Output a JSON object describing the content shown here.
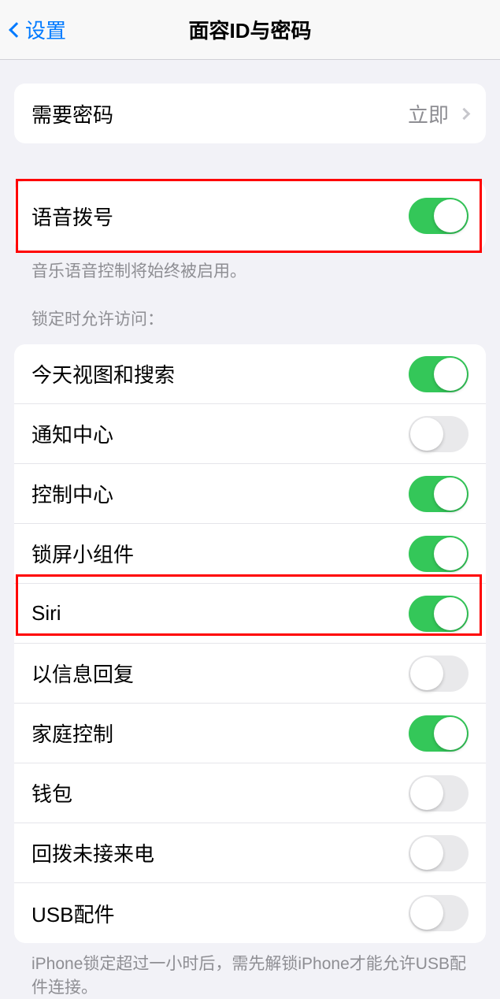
{
  "nav": {
    "back_label": "设置",
    "title": "面容ID与密码"
  },
  "require_passcode": {
    "label": "需要密码",
    "value": "立即"
  },
  "voice_dial": {
    "label": "语音拨号",
    "on": true,
    "footer": "音乐语音控制将始终被启用。"
  },
  "lock_access": {
    "header": "锁定时允许访问：",
    "items": [
      {
        "label": "今天视图和搜索",
        "on": true
      },
      {
        "label": "通知中心",
        "on": false
      },
      {
        "label": "控制中心",
        "on": true
      },
      {
        "label": "锁屏小组件",
        "on": true
      },
      {
        "label": "Siri",
        "on": true
      },
      {
        "label": "以信息回复",
        "on": false
      },
      {
        "label": "家庭控制",
        "on": true
      },
      {
        "label": "钱包",
        "on": false
      },
      {
        "label": "回拨未接来电",
        "on": false
      },
      {
        "label": "USB配件",
        "on": false
      }
    ],
    "footer": "iPhone锁定超过一小时后，需先解锁iPhone才能允许USB配件连接。"
  }
}
